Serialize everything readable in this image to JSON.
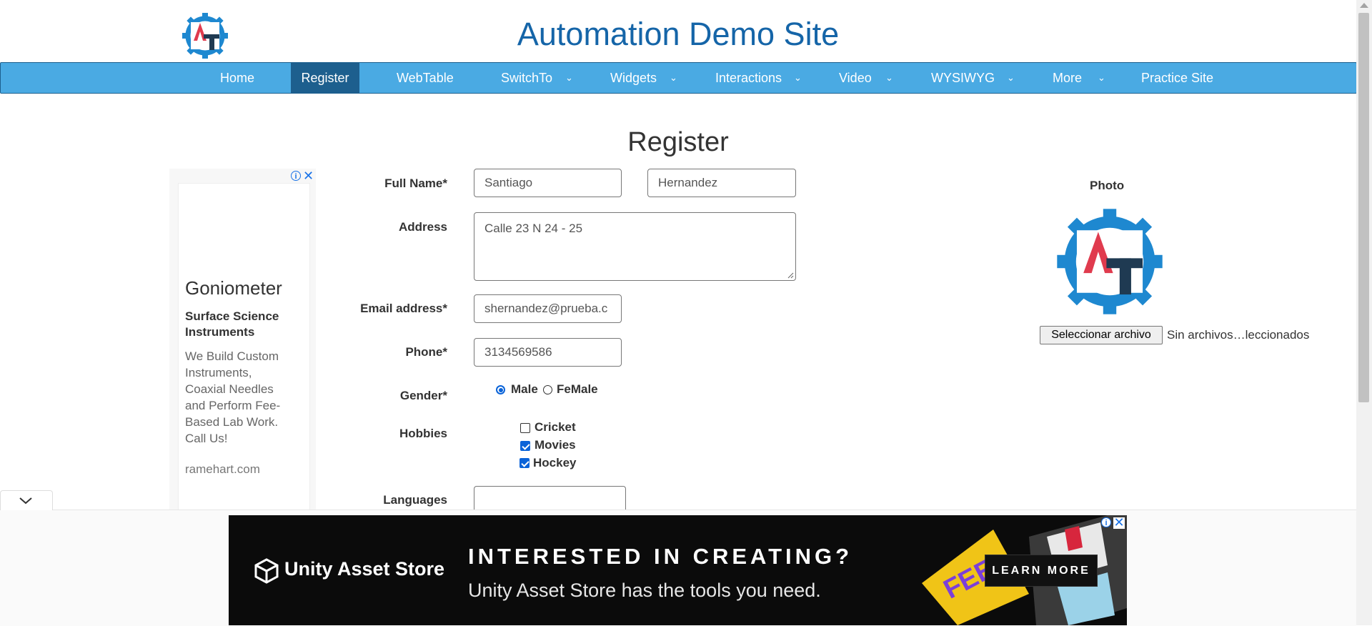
{
  "header": {
    "site_title": "Automation Demo Site",
    "logo_text": "AT"
  },
  "nav": {
    "items": [
      {
        "label": "Home",
        "has_dropdown": false,
        "active": false
      },
      {
        "label": "Register",
        "has_dropdown": false,
        "active": true
      },
      {
        "label": "WebTable",
        "has_dropdown": false,
        "active": false
      },
      {
        "label": "SwitchTo",
        "has_dropdown": true,
        "active": false
      },
      {
        "label": "Widgets",
        "has_dropdown": true,
        "active": false
      },
      {
        "label": "Interactions",
        "has_dropdown": true,
        "active": false
      },
      {
        "label": "Video",
        "has_dropdown": true,
        "active": false
      },
      {
        "label": "WYSIWYG",
        "has_dropdown": true,
        "active": false
      },
      {
        "label": "More",
        "has_dropdown": true,
        "active": false
      },
      {
        "label": "Practice Site",
        "has_dropdown": false,
        "active": false
      }
    ],
    "dropdown_glyph": "⌄"
  },
  "form": {
    "heading": "Register",
    "labels": {
      "full_name": "Full Name*",
      "address": "Address",
      "email": "Email address*",
      "phone": "Phone*",
      "gender": "Gender*",
      "hobbies": "Hobbies",
      "languages": "Languages"
    },
    "values": {
      "first_name": "Santiago",
      "last_name": "Hernandez",
      "address": "Calle 23 N 24 - 25",
      "email": "shernandez@prueba.c",
      "phone": "3134569586",
      "languages": ""
    },
    "gender": {
      "options": [
        {
          "label": "Male",
          "checked": true
        },
        {
          "label": "FeMale",
          "checked": false
        }
      ]
    },
    "hobbies": [
      {
        "label": "Cricket",
        "checked": false
      },
      {
        "label": "Movies",
        "checked": true
      },
      {
        "label": "Hockey",
        "checked": true
      }
    ]
  },
  "photo": {
    "label": "Photo",
    "file_button": "Seleccionar archivo",
    "file_status": "Sin archivos…leccionados"
  },
  "left_ad": {
    "title": "Goniometer",
    "company": "Surface Science Instruments",
    "body": "We Build Custom Instruments, Coaxial Needles and Perform Fee-Based Lab Work. Call Us!",
    "domain": "ramehart.com",
    "info_glyph": "i",
    "close_glyph": "✕"
  },
  "bottom_ad": {
    "brand": "Unity Asset Store",
    "headline": "INTERESTED IN CREATING?",
    "subline": "Unity Asset Store has the tools you need.",
    "cta": "LEARN MORE",
    "art_text": "FEEL",
    "info_glyph": "i",
    "close_glyph": "✕"
  },
  "collapse_glyph": "⌄",
  "colors": {
    "nav_bg": "#4aaae3",
    "nav_active": "#1d5f8e",
    "title_blue": "#1565a8",
    "check_blue": "#0a63d8"
  }
}
